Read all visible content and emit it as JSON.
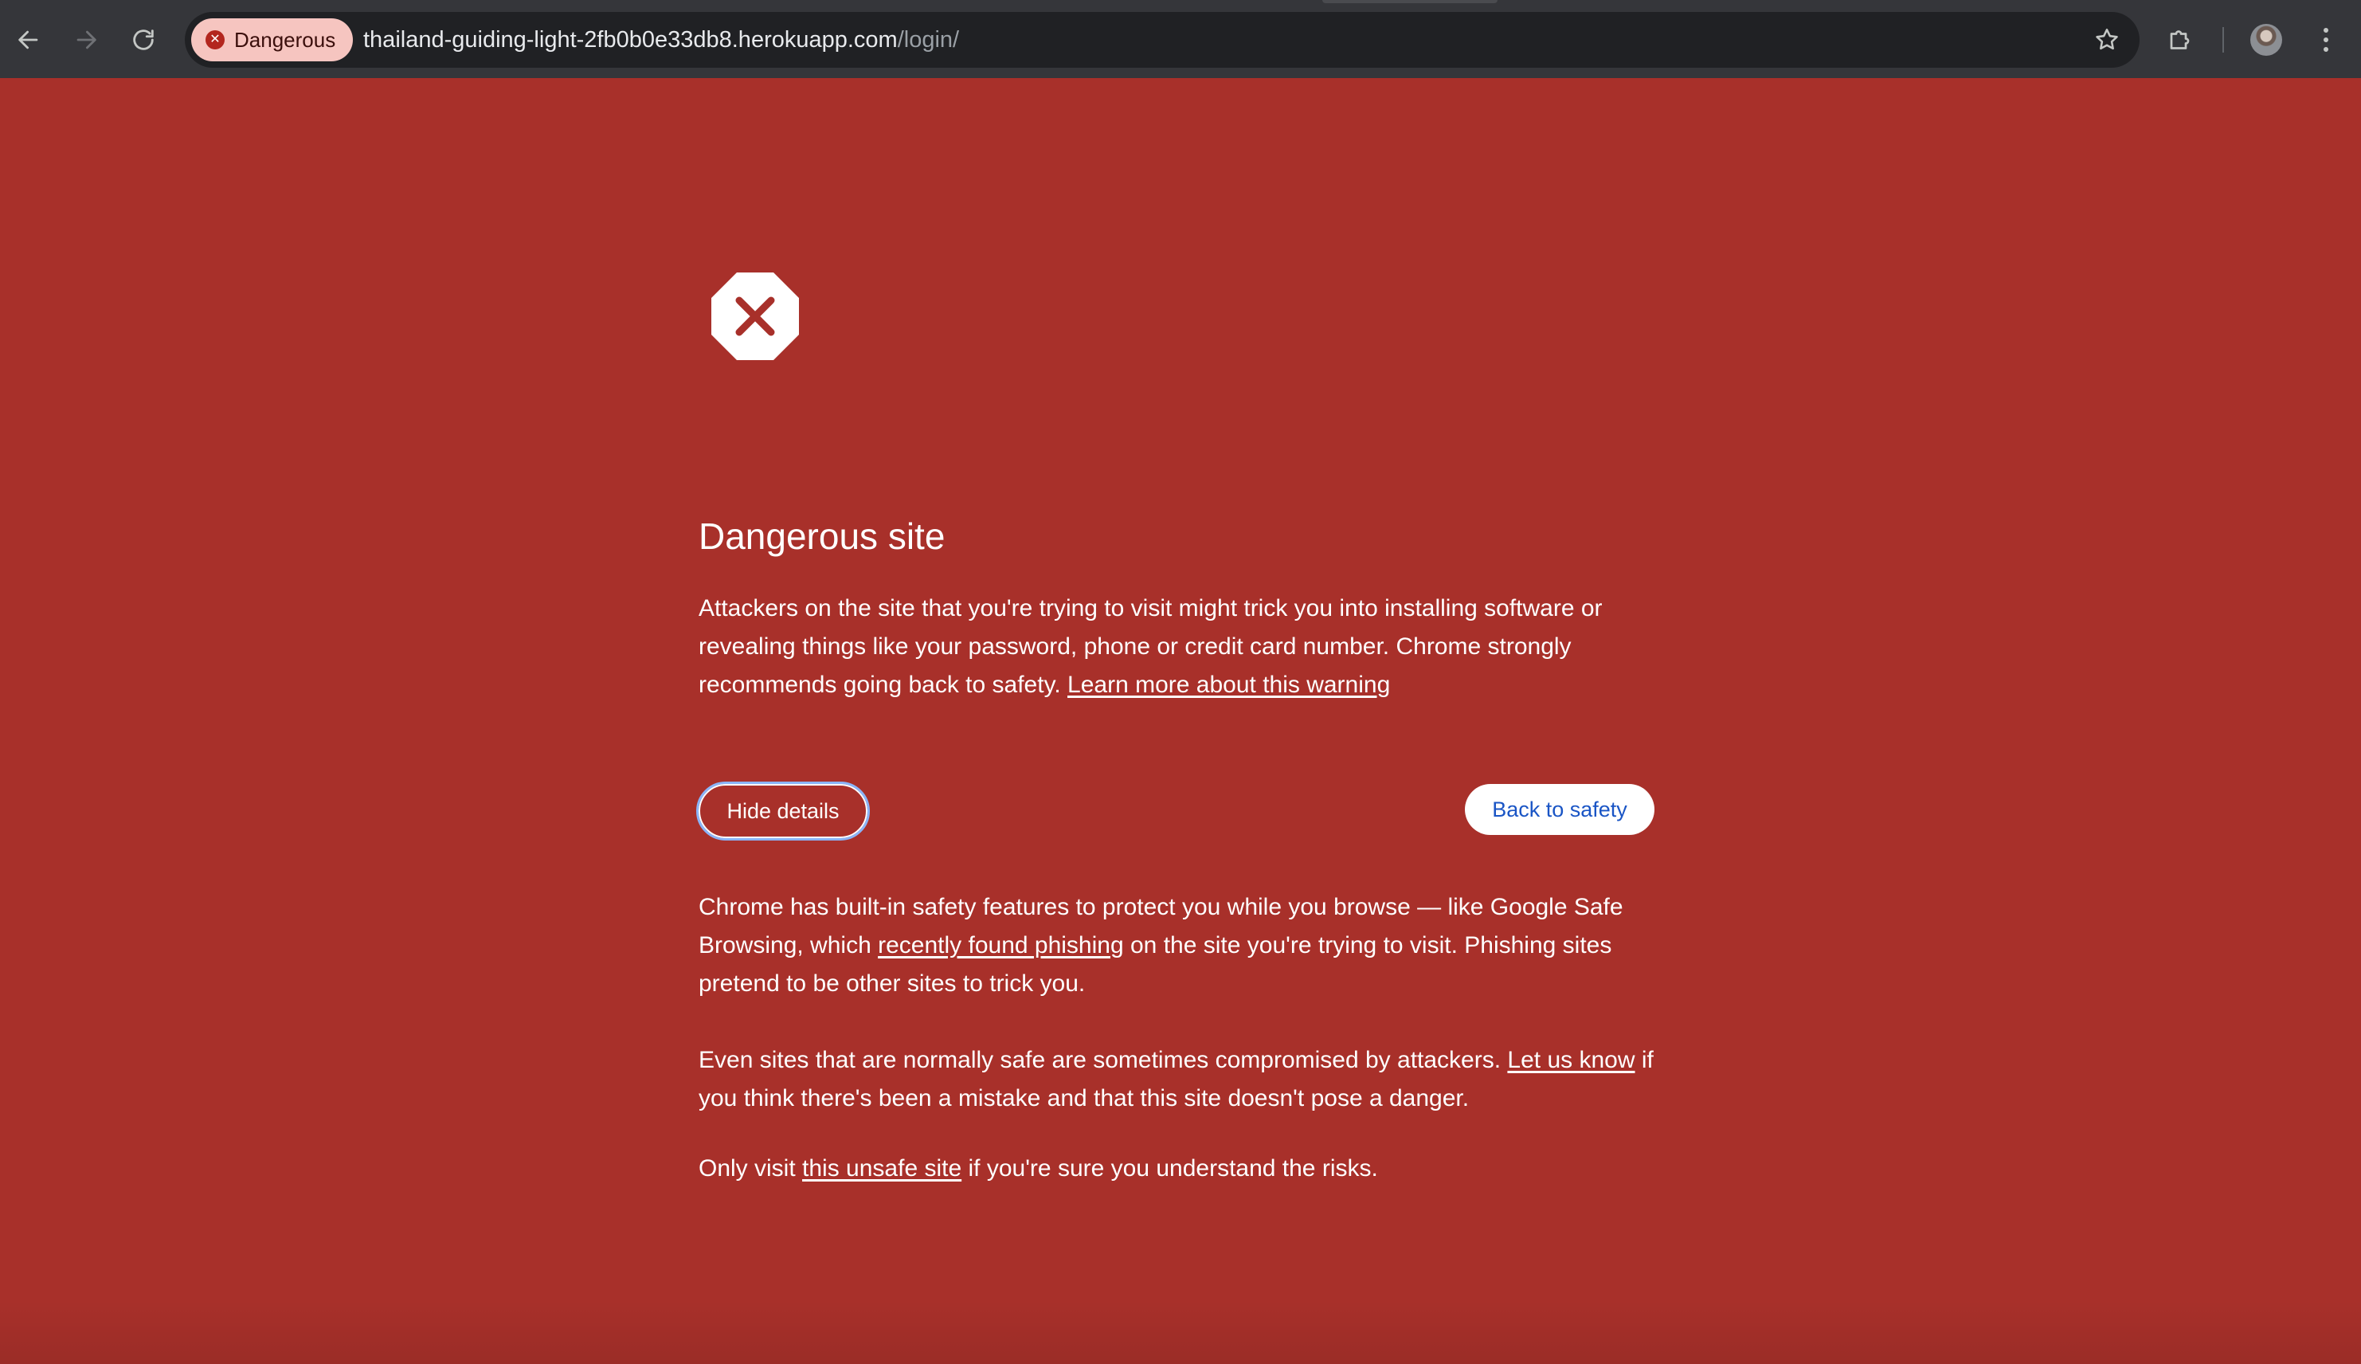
{
  "browser": {
    "security_chip_label": "Dangerous",
    "url_host": "thailand-guiding-light-2fb0b0e33db8.herokuapp.com",
    "url_path": "/login/"
  },
  "warning": {
    "title": "Dangerous site",
    "intro_text": "Attackers on the site that you're trying to visit might trick you into installing software or revealing things like your password, phone or credit card number. Chrome strongly recommends going back to safety.",
    "learn_more_link": "Learn more about this warning",
    "hide_details_button": "Hide details",
    "back_to_safety_button": "Back to safety",
    "details": {
      "p1_before": "Chrome has built-in safety features to protect you while you browse — like Google Safe Browsing, which",
      "p1_link": "recently found phishing",
      "p1_after": "on the site you're trying to visit. Phishing sites pretend to be other sites to trick you.",
      "p2_before": "Even sites that are normally safe are sometimes compromised by attackers.",
      "p2_link": "Let us know",
      "p2_after": "if you think there's been a mistake and that this site doesn't pose a danger.",
      "p3_before": "Only visit",
      "p3_link": "this unsafe site",
      "p3_after": "if you're sure you understand the risks."
    }
  },
  "colors": {
    "background": "#a8302a",
    "toolbar": "#35363a",
    "omnibox": "#202124",
    "chip_bg": "#f6c5c0",
    "focus_ring": "#8ab4f8",
    "primary_link": "#1a55c5"
  },
  "icons": [
    "back-arrow-icon",
    "forward-arrow-icon",
    "reload-icon",
    "danger-chip-icon",
    "bookmark-star-icon",
    "extensions-puzzle-icon",
    "profile-avatar-icon",
    "more-menu-icon",
    "stop-octagon-icon"
  ]
}
